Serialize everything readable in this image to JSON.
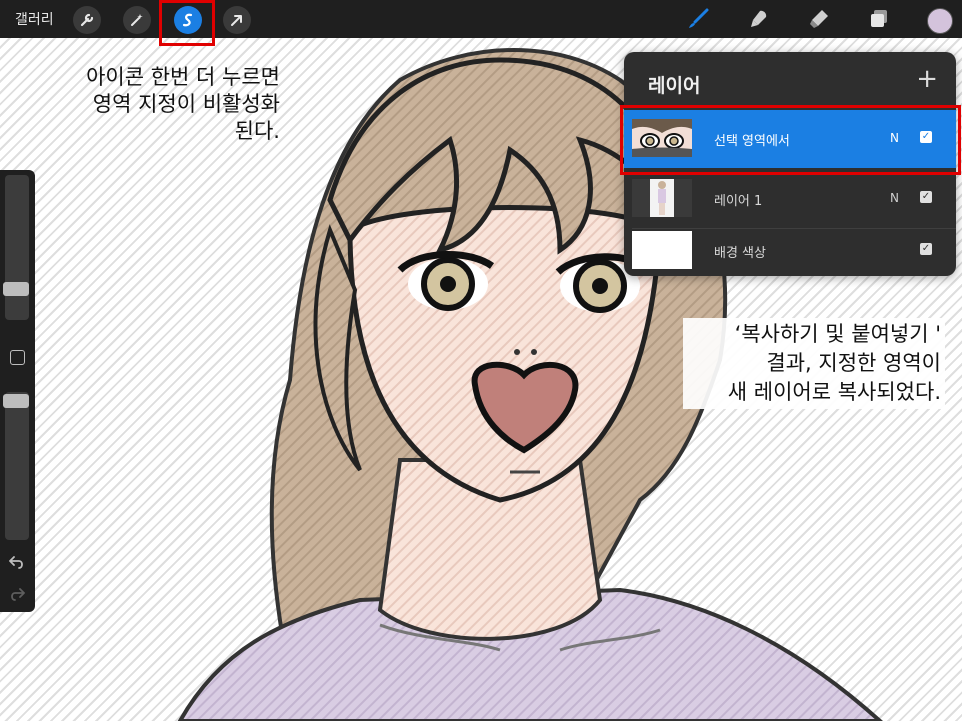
{
  "toolbar": {
    "gallery_label": "갤러리",
    "left_tools": [
      "wrench-icon",
      "magic-wand-icon",
      "selection-icon",
      "move-arrow-icon"
    ],
    "right_tools": [
      "brush-icon",
      "smudge-icon",
      "eraser-icon",
      "layers-icon"
    ],
    "current_color": "#d4c3dc",
    "accent_color": "#1b7fe3"
  },
  "sidebar": {
    "brush_size_level": 0.25,
    "opacity_level": 0.1,
    "tools": [
      "modify-square-icon",
      "undo-icon",
      "redo-icon"
    ]
  },
  "annotations": {
    "top_left": [
      "아이콘 한번 더 누르면",
      "영역 지정이 비활성화",
      "된다."
    ],
    "right": [
      "‘복사하기 및 붙여넣기 '",
      "결과, 지정한 영역이",
      "새 레이어로 복사되었다."
    ],
    "highlight_color": "#e00000"
  },
  "layers_panel": {
    "title": "레이어",
    "add_label": "+",
    "layers": [
      {
        "name": "선택 영역에서",
        "blend": "N",
        "visible": true,
        "selected": true
      },
      {
        "name": "레이어 1",
        "blend": "N",
        "visible": true,
        "selected": false
      },
      {
        "name": "배경 색상",
        "blend": "",
        "visible": true,
        "selected": false
      }
    ]
  }
}
